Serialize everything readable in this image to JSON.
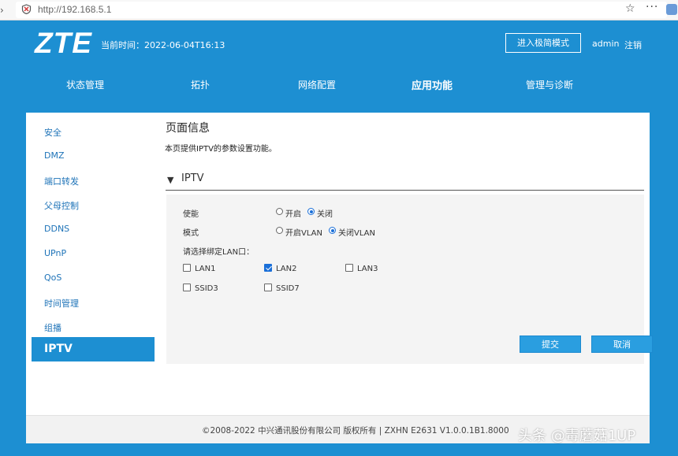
{
  "browser": {
    "url": "http://192.168.5.1"
  },
  "header": {
    "logo": "ZTE",
    "time": "当前时间：2022-06-04T16:13",
    "simple_mode": "进入极简模式",
    "user": "admin",
    "logout": "注销"
  },
  "nav": [
    {
      "label": "状态管理"
    },
    {
      "label": "拓扑"
    },
    {
      "label": "网络配置"
    },
    {
      "label": "应用功能"
    },
    {
      "label": "管理与诊断"
    }
  ],
  "sidebar": [
    {
      "label": "安全"
    },
    {
      "label": "DMZ"
    },
    {
      "label": "端口转发"
    },
    {
      "label": "父母控制"
    },
    {
      "label": "DDNS"
    },
    {
      "label": "UPnP"
    },
    {
      "label": "QoS"
    },
    {
      "label": "时间管理"
    },
    {
      "label": "组播"
    },
    {
      "label": "IPTV"
    }
  ],
  "page": {
    "title": "页面信息",
    "description": "本页提供IPTV的参数设置功能。",
    "section": "IPTV"
  },
  "form": {
    "enable_label": "使能",
    "enable_options": [
      "开启",
      "关闭"
    ],
    "enable_selected": "关闭",
    "mode_label": "模式",
    "mode_options": [
      "开启VLAN",
      "关闭VLAN"
    ],
    "mode_selected": "关闭VLAN",
    "lan_select_label": "请选择绑定LAN口：",
    "ports": [
      {
        "label": "LAN1",
        "checked": false
      },
      {
        "label": "LAN2",
        "checked": true
      },
      {
        "label": "LAN3",
        "checked": false
      },
      {
        "label": "SSID3",
        "checked": false
      },
      {
        "label": "SSID7",
        "checked": false
      }
    ],
    "submit": "提交",
    "cancel": "取消"
  },
  "footer": {
    "text": "©2008-2022 中兴通讯股份有限公司 版权所有  |   ZXHN E2631 V1.0.0.1B1.8000"
  },
  "watermark": "头条 @毒蘑菇1UP",
  "colors": {
    "primary": "#1d8fd2",
    "button": "#2a9ee0",
    "link": "#1e73b8"
  }
}
